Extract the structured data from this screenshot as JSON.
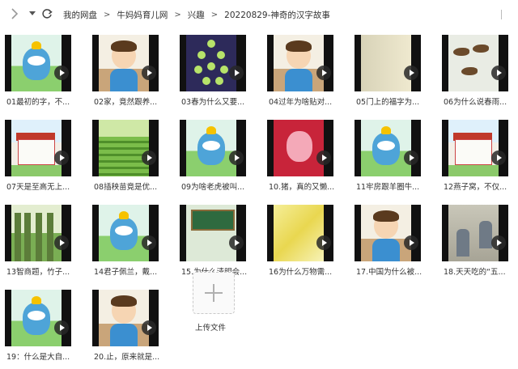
{
  "breadcrumb": [
    "我的网盘",
    "牛妈妈育儿网",
    "兴趣",
    "20220829-神奇的汉字故事"
  ],
  "breadcrumb_separator": ">",
  "nav": {
    "back_icon": "chevron-left-icon",
    "dropdown_icon": "caret-down-icon",
    "refresh_icon": "refresh-icon"
  },
  "videos": [
    {
      "title": "01最初的字，不...",
      "scene": "cat"
    },
    {
      "title": "02家，竟然跟养...",
      "scene": "boy"
    },
    {
      "title": "03春为什么又要...",
      "scene": "night"
    },
    {
      "title": "04过年为啥贴对...",
      "scene": "boy"
    },
    {
      "title": "05门上的福字为...",
      "scene": "paper"
    },
    {
      "title": "06为什么说春雨...",
      "scene": "bird"
    },
    {
      "title": "07天是至高无上...",
      "scene": "house"
    },
    {
      "title": "08插秧苗竟是优...",
      "scene": "field"
    },
    {
      "title": "09为啥老虎被叫...",
      "scene": "cat"
    },
    {
      "title": "10.猪，真的又懒...",
      "scene": "red"
    },
    {
      "title": "11牢房跟羊圈牛...",
      "scene": "cat"
    },
    {
      "title": "12燕子窝，不仅...",
      "scene": "house"
    },
    {
      "title": "13智商题，竹子...",
      "scene": "forest"
    },
    {
      "title": "14君子佩兰，戴...",
      "scene": "cat"
    },
    {
      "title": "15.为什么清明会...",
      "scene": "classroom"
    },
    {
      "title": "16为什么万物需...",
      "scene": "yellow"
    },
    {
      "title": "17.中国为什么被...",
      "scene": "boy"
    },
    {
      "title": "18.天天吃的“五...",
      "scene": "old"
    },
    {
      "title": "19：什么是大自...",
      "scene": "cat"
    },
    {
      "title": "20.止，原来就是...",
      "scene": "boy"
    }
  ],
  "upload": {
    "label": "上传文件",
    "icon": "plus-icon"
  },
  "colors": {
    "play_button": "#282828",
    "background": "#ffffff"
  }
}
